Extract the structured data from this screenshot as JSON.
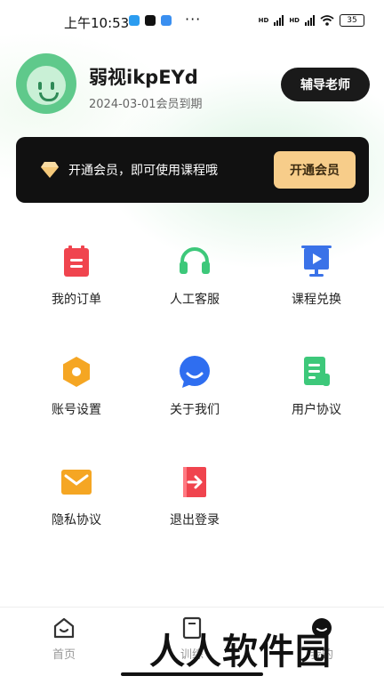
{
  "status": {
    "time": "上午10:53",
    "battery": "35",
    "dots": "···",
    "network": "HD"
  },
  "profile": {
    "name": "弱视ikpEYd",
    "expire": "2024-03-01会员到期",
    "tutor_button": "辅导老师"
  },
  "vip": {
    "text": "开通会员，即可使用课程哦",
    "button": "开通会员"
  },
  "menu": [
    {
      "label": "我的订单",
      "icon": "order-icon",
      "color": "#f0444e"
    },
    {
      "label": "人工客服",
      "icon": "headset-icon",
      "color": "#3dc87a"
    },
    {
      "label": "课程兑换",
      "icon": "presentation-icon",
      "color": "#3a72e8"
    },
    {
      "label": "账号设置",
      "icon": "settings-hex-icon",
      "color": "#f5a623"
    },
    {
      "label": "关于我们",
      "icon": "chat-smile-icon",
      "color": "#2f6ef0"
    },
    {
      "label": "用户协议",
      "icon": "document-icon",
      "color": "#3dc87a"
    },
    {
      "label": "隐私协议",
      "icon": "envelope-icon",
      "color": "#f5a623"
    },
    {
      "label": "退出登录",
      "icon": "logout-icon",
      "color": "#f0444e"
    }
  ],
  "tabs": [
    {
      "label": "首页",
      "icon": "home-icon"
    },
    {
      "label": "训练",
      "icon": "book-icon"
    },
    {
      "label": "我的",
      "icon": "profile-icon"
    }
  ],
  "watermark": "人人软件园"
}
